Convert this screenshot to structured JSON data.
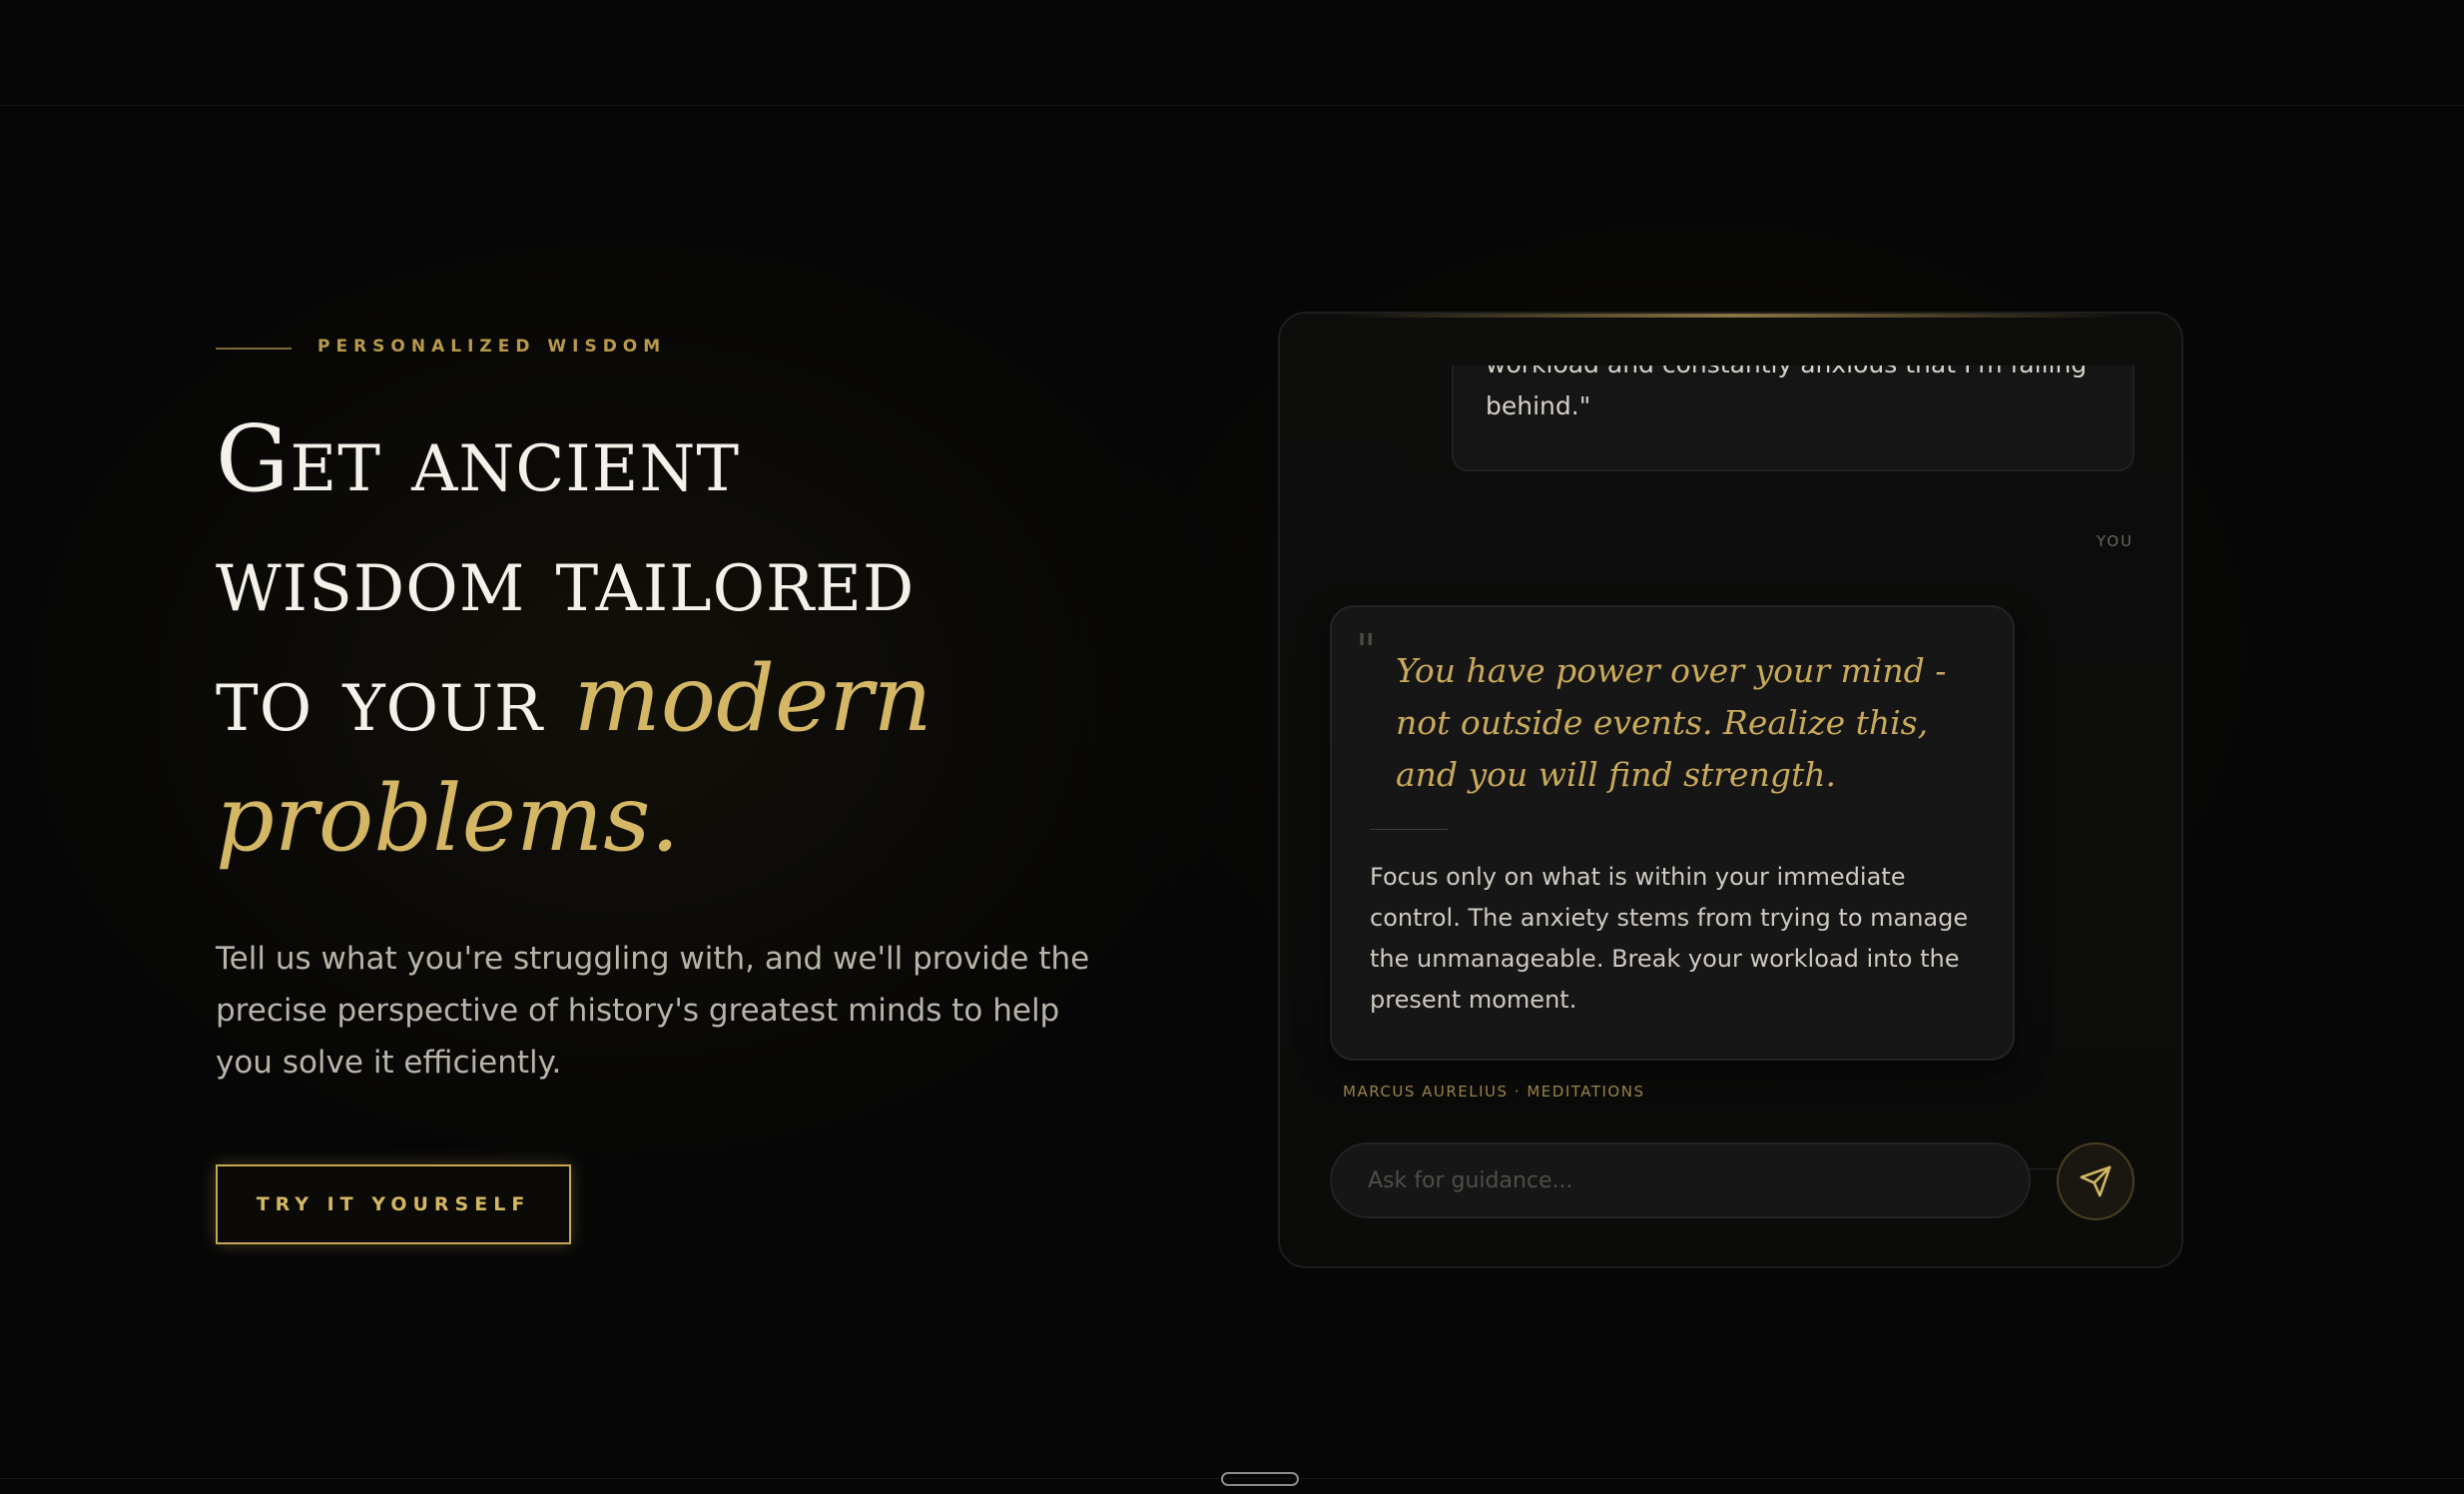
{
  "hero": {
    "eyebrow": "PERSONALIZED WISDOM",
    "headline_line1": "Get ancient",
    "headline_line2": "wisdom tailored",
    "headline_line3_plain": "to your ",
    "headline_accent1": "modern",
    "headline_accent2": "problems.",
    "subtext": "Tell us what you're struggling with, and we'll provide the precise perspective of history's greatest minds to help you solve it efficiently.",
    "cta_label": "TRY IT YOURSELF"
  },
  "chat": {
    "user_message_partial": "workload and constantly anxious that I'm falling",
    "user_message_end": "behind.\"",
    "user_label": "YOU",
    "quote_mark": "\"",
    "quote": "You have power over your mind - not outside events. Realize this, and you will find strength.",
    "advice": "Focus only on what is within your immediate control. The anxiety stems from trying to manage the unmanageable. Break your workload into the present moment.",
    "source": "MARCUS AURELIUS · MEDITATIONS",
    "input_placeholder": "Ask for guidance...",
    "send_icon": "paper-plane-icon"
  },
  "colors": {
    "background": "#060606",
    "gold_accent": "#d4b764",
    "text_primary": "#f4f1ea",
    "text_muted": "#b9b4aa"
  }
}
